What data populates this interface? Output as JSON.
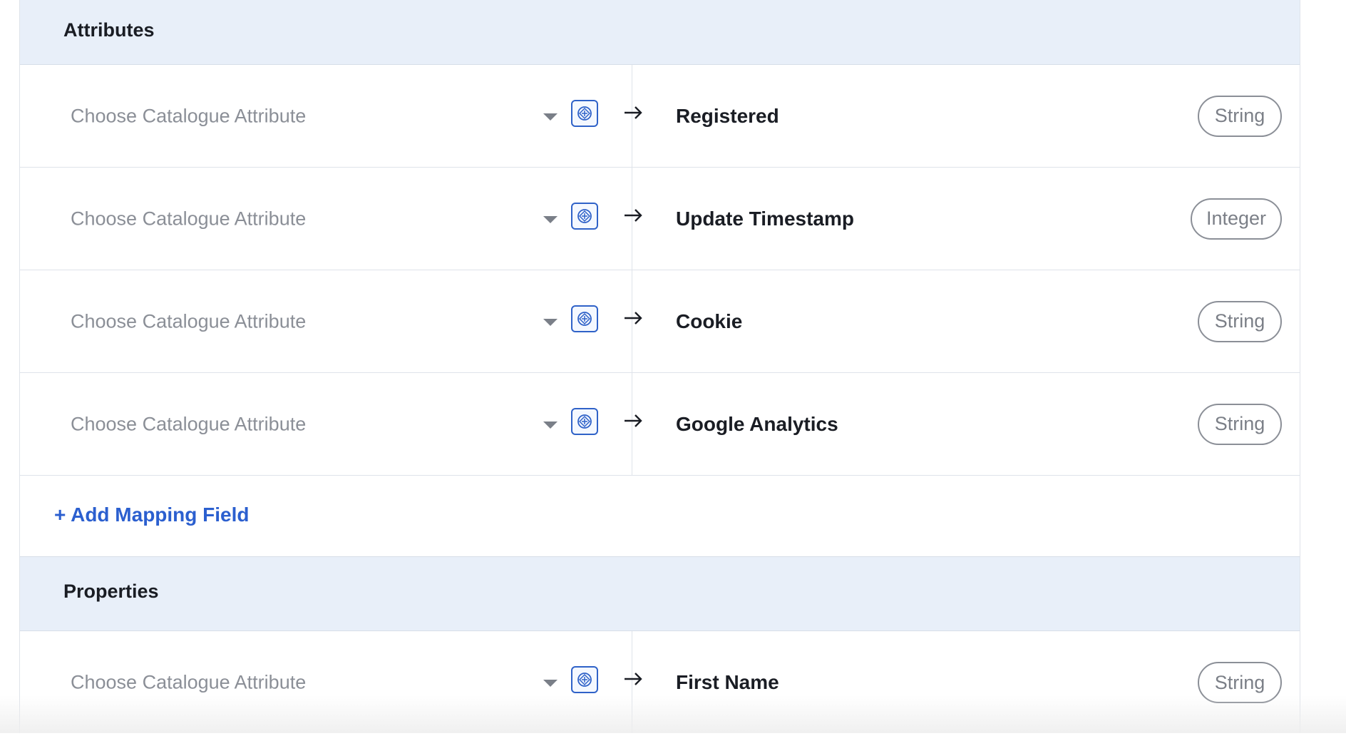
{
  "sections": {
    "attributes": {
      "title": "Attributes",
      "rows": [
        {
          "placeholder": "Choose Catalogue Attribute",
          "field": "Registered",
          "type": "String"
        },
        {
          "placeholder": "Choose Catalogue Attribute",
          "field": "Update Timestamp",
          "type": "Integer"
        },
        {
          "placeholder": "Choose Catalogue Attribute",
          "field": "Cookie",
          "type": "String"
        },
        {
          "placeholder": "Choose Catalogue Attribute",
          "field": "Google Analytics",
          "type": "String"
        }
      ],
      "add_label": "+ Add Mapping Field"
    },
    "properties": {
      "title": "Properties",
      "rows": [
        {
          "placeholder": "Choose Catalogue Attribute",
          "field": "First Name",
          "type": "String"
        }
      ]
    }
  },
  "icons": {
    "caret": "chevron-down-icon",
    "lookup": "target-diamond-icon",
    "arrow": "arrow-right-icon"
  },
  "colors": {
    "header_bg": "#e8eff9",
    "accent": "#2b5fcf",
    "placeholder": "#8b8f97"
  }
}
